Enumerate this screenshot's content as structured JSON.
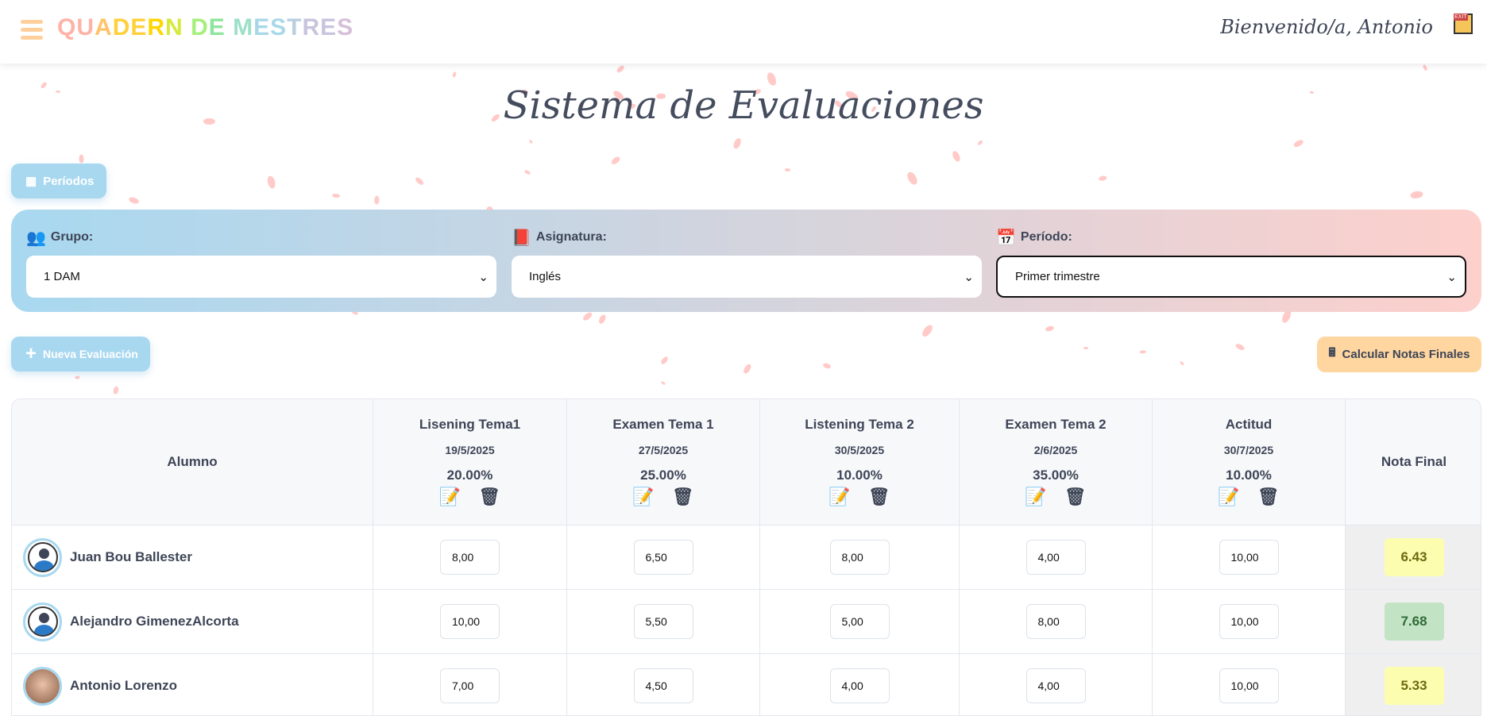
{
  "header": {
    "logo": "QUADERN DE MESTRES",
    "welcome": "Bienvenido/a, Antonio"
  },
  "title": "Sistema de Evaluaciones",
  "periods_button": "Períodos",
  "filters": {
    "group_label": "Grupo:",
    "group_value": "1 DAM",
    "subject_label": "Asignatura:",
    "subject_value": "Inglés",
    "period_label": "Período:",
    "period_value": "Primer trimestre"
  },
  "new_eval_button": "Nueva Evaluación",
  "calc_button": "Calcular Notas Finales",
  "table": {
    "student_header": "Alumno",
    "final_header": "Nota Final",
    "evaluations": [
      {
        "name": "Lisening Tema1",
        "date": "19/5/2025",
        "weight": "20.00%"
      },
      {
        "name": "Examen Tema 1",
        "date": "27/5/2025",
        "weight": "25.00%"
      },
      {
        "name": "Listening Tema 2",
        "date": "30/5/2025",
        "weight": "10.00%"
      },
      {
        "name": "Examen Tema 2",
        "date": "2/6/2025",
        "weight": "35.00%"
      },
      {
        "name": "Actitud",
        "date": "30/7/2025",
        "weight": "10.00%"
      }
    ],
    "rows": [
      {
        "name": "Juan Bou Ballester",
        "grades": [
          "8,00",
          "6,50",
          "8,00",
          "4,00",
          "10,00"
        ],
        "final": "6.43",
        "final_color": "#fdfdb0"
      },
      {
        "name": "Alejandro GimenezAlcorta",
        "grades": [
          "10,00",
          "5,50",
          "5,00",
          "8,00",
          "10,00"
        ],
        "final": "7.68",
        "final_color": "#c3e3c5"
      },
      {
        "name": "Antonio Lorenzo",
        "grades": [
          "7,00",
          "4,50",
          "4,00",
          "4,00",
          "10,00"
        ],
        "final": "5.33",
        "final_color": "#fdfdb0"
      }
    ]
  }
}
